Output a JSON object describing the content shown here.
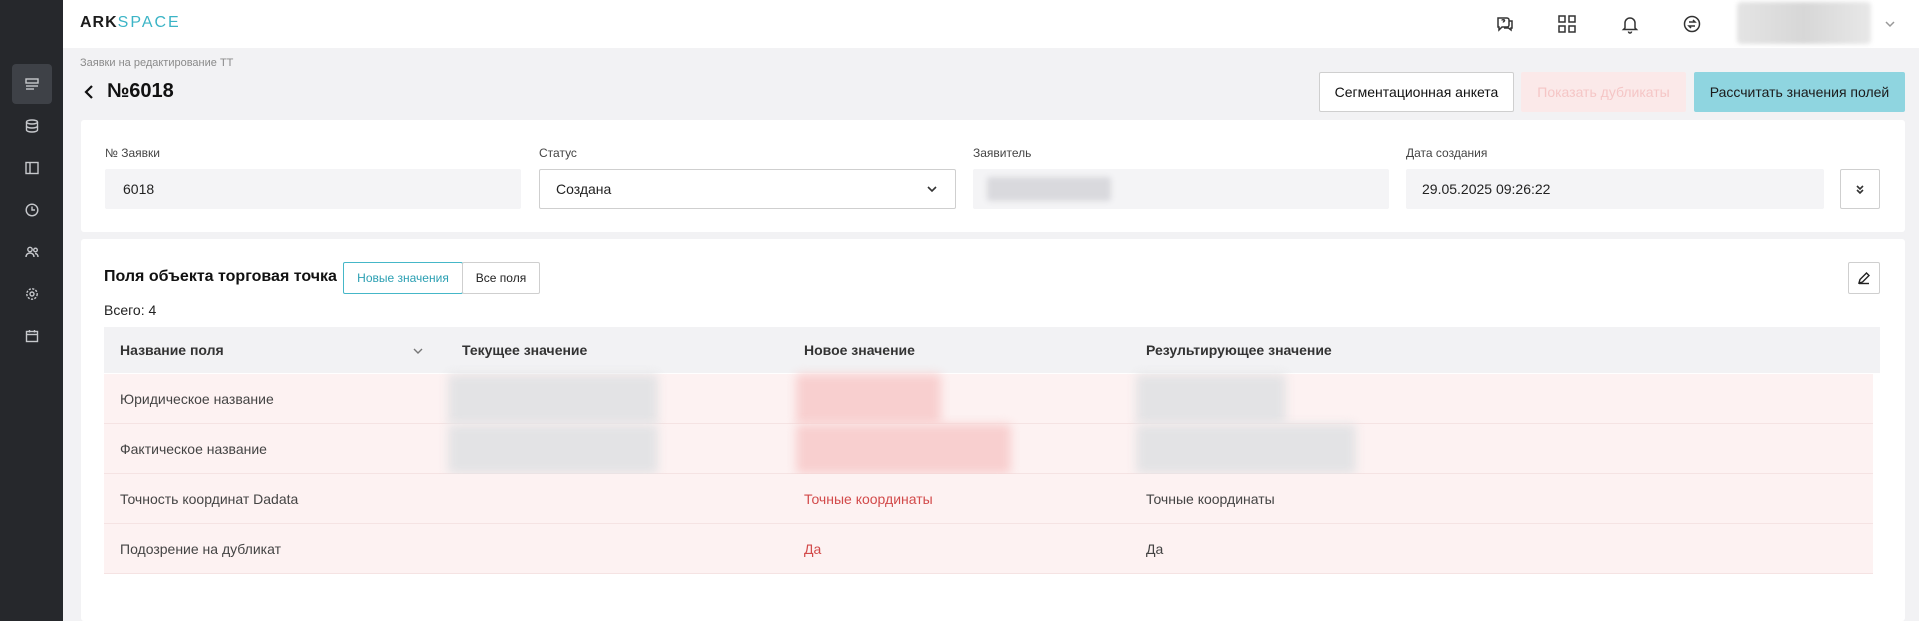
{
  "brand": {
    "part1": "ARK",
    "part2": "SPACE"
  },
  "header": {
    "icons": [
      "chat-question-icon",
      "apps-grid-icon",
      "bell-icon",
      "sync-icon"
    ]
  },
  "sidebar": {
    "items": [
      "requests-icon",
      "database-icon",
      "layout-icon",
      "clock-icon",
      "users-icon",
      "settings-icon",
      "calendar-icon"
    ]
  },
  "breadcrumb": "Заявки на редактирование ТТ",
  "page": {
    "title": "№6018"
  },
  "actions": {
    "segmentation": "Сегментационная анкета",
    "duplicates": "Показать дубликаты",
    "calculate": "Рассчитать значения полей"
  },
  "fields": {
    "number": {
      "label": "№ Заявки",
      "value": "6018"
    },
    "status": {
      "label": "Статус",
      "value": "Создана"
    },
    "applicant": {
      "label": "Заявитель"
    },
    "created": {
      "label": "Дата создания",
      "value": "29.05.2025 09:26:22"
    }
  },
  "section": {
    "title": "Поля объекта торговая точка",
    "toggle_new": "Новые значения",
    "toggle_all": "Все поля",
    "total": "Всего: 4"
  },
  "table": {
    "columns": [
      "Название поля",
      "Текущее значение",
      "Новое значение",
      "Результирующее значение"
    ],
    "rows": [
      {
        "name": "Юридическое название",
        "current": "",
        "new": "",
        "result": ""
      },
      {
        "name": "Фактическое название",
        "current": "",
        "new": "",
        "result": ""
      },
      {
        "name": "Точность координат Dadata",
        "current": "",
        "new": "Точные координаты",
        "result": "Точные координаты"
      },
      {
        "name": "Подозрение на дубликат",
        "current": "",
        "new": "Да",
        "result": "Да"
      }
    ]
  }
}
